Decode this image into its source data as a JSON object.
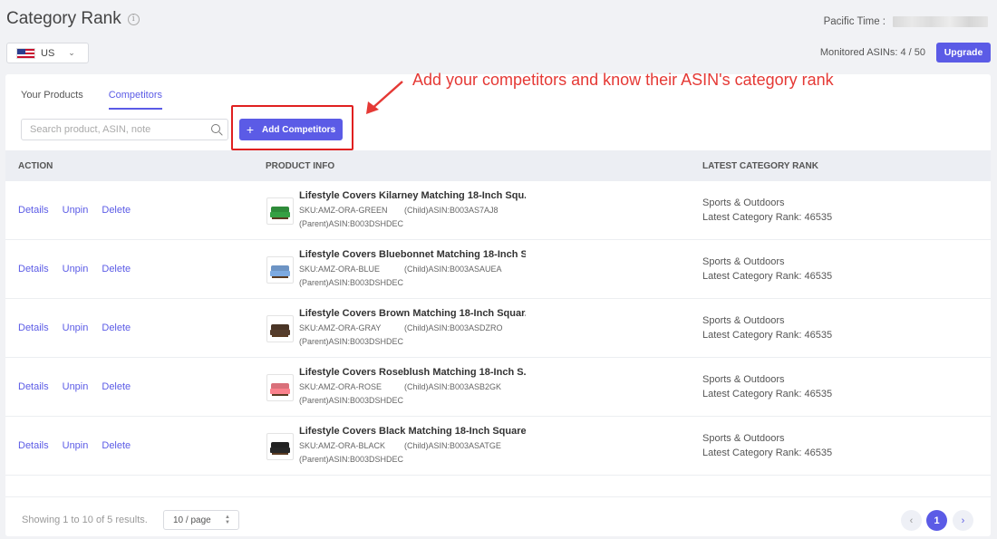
{
  "header": {
    "title": "Category Rank",
    "info_icon": "i",
    "pacific_label": "Pacific Time :",
    "country": "US",
    "monitored": "Monitored ASINs: 4 / 50",
    "upgrade_label": "Upgrade"
  },
  "tabs": [
    {
      "label": "Your Products",
      "active": false
    },
    {
      "label": "Competitors",
      "active": true
    }
  ],
  "search": {
    "placeholder": "Search product, ASIN, note"
  },
  "add_button": {
    "plus": "+",
    "label": "Add Competitors"
  },
  "annotation": "Add your competitors and know their ASIN's category rank",
  "table": {
    "headers": [
      "ACTION",
      "PRODUCT INFO",
      "LATEST CATEGORY RANK"
    ],
    "action_labels": [
      "Details",
      "Unpin",
      "Delete"
    ],
    "rows": [
      {
        "title": "Lifestyle Covers Kilarney Matching 18-Inch Squ...",
        "sku": "SKU:AMZ-ORA-GREEN",
        "child": "(Child)ASIN:B003AS7AJ8",
        "parent": "(Parent)ASIN:B003DSHDEC",
        "category": "Sports & Outdoors",
        "rank": "Latest Category Rank: 46535",
        "color": "#2e8b3a"
      },
      {
        "title": "Lifestyle Covers Bluebonnet Matching 18-Inch S...",
        "sku": "SKU:AMZ-ORA-BLUE",
        "child": "(Child)ASIN:B003ASAUEA",
        "parent": "(Parent)ASIN:B003DSHDEC",
        "category": "Sports & Outdoors",
        "rank": "Latest Category Rank: 46535",
        "color": "#6d94c4"
      },
      {
        "title": "Lifestyle Covers Brown Matching 18-Inch Squar...",
        "sku": "SKU:AMZ-ORA-GRAY",
        "child": "(Child)ASIN:B003ASDZRO",
        "parent": "(Parent)ASIN:B003DSHDEC",
        "category": "Sports & Outdoors",
        "rank": "Latest Category Rank: 46535",
        "color": "#4a3526"
      },
      {
        "title": "Lifestyle Covers Roseblush Matching 18-Inch S...",
        "sku": "SKU:AMZ-ORA-ROSE",
        "child": "(Child)ASIN:B003ASB2GK",
        "parent": "(Parent)ASIN:B003DSHDEC",
        "category": "Sports & Outdoors",
        "rank": "Latest Category Rank: 46535",
        "color": "#d9707a"
      },
      {
        "title": "Lifestyle Covers Black Matching 18-Inch Square...",
        "sku": "SKU:AMZ-ORA-BLACK",
        "child": "(Child)ASIN:B003ASATGE",
        "parent": "(Parent)ASIN:B003DSHDEC",
        "category": "Sports & Outdoors",
        "rank": "Latest Category Rank: 46535",
        "color": "#222222"
      }
    ]
  },
  "footer": {
    "showing": "Showing 1 to 10 of 5 results.",
    "per_page": "10 / page",
    "prev": "‹",
    "current_page": "1",
    "next": "›"
  },
  "colors": {
    "accent": "#5b5be6",
    "annotation": "#e53935"
  }
}
